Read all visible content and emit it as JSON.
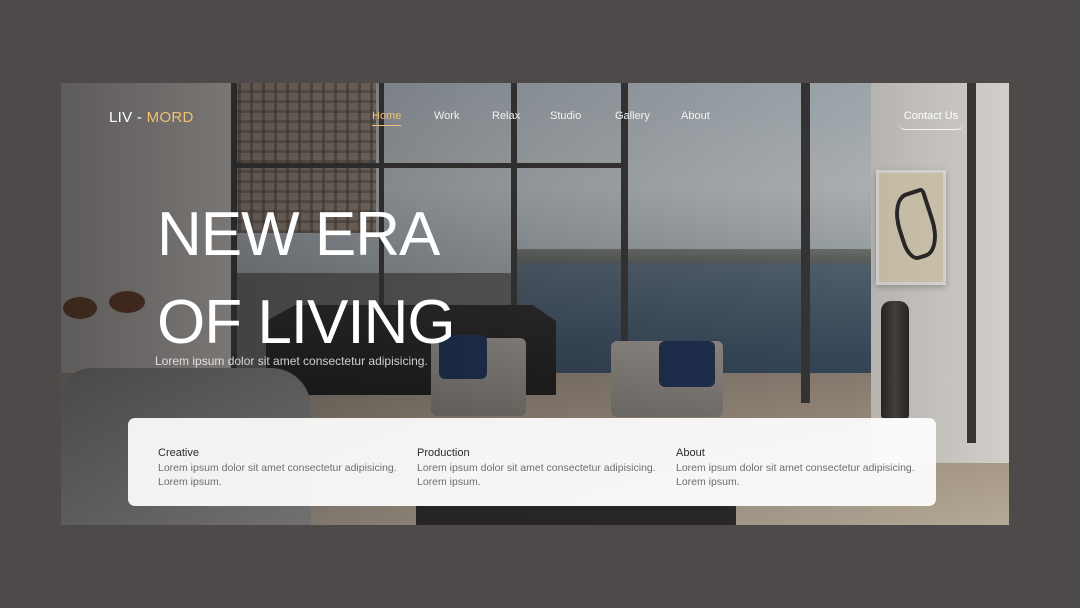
{
  "brand": {
    "name_first": "LIV -",
    "name_second": "MORD",
    "accent_color": "#f0c074"
  },
  "nav": {
    "items": [
      {
        "label": "Home",
        "active": true
      },
      {
        "label": "Work",
        "active": false
      },
      {
        "label": "Relax",
        "active": false
      },
      {
        "label": "Studio",
        "active": false
      },
      {
        "label": "Gallery",
        "active": false
      },
      {
        "label": "About",
        "active": false
      }
    ],
    "contact_label": "Contact Us"
  },
  "hero": {
    "title_line1": "NEW ERA",
    "title_line2": "OF LIVING",
    "subtitle": "Lorem ipsum dolor sit amet consectetur adipisicing."
  },
  "features": [
    {
      "title": "Creative",
      "text": "Lorem ipsum dolor sit amet consectetur adipisicing. Lorem ipsum."
    },
    {
      "title": "Production",
      "text": "Lorem ipsum dolor sit amet consectetur adipisicing. Lorem ipsum."
    },
    {
      "title": "About",
      "text": "Lorem ipsum dolor sit amet consectetur adipisicing. Lorem ipsum."
    }
  ],
  "colors": {
    "page_background": "#4f4a4a",
    "accent": "#f0c074",
    "panel": "#ffffff"
  }
}
